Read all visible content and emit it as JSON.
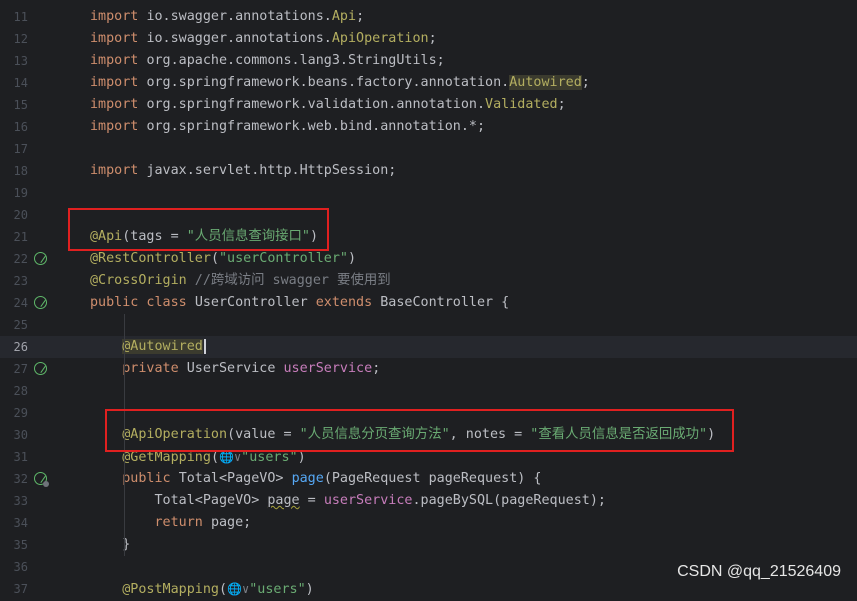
{
  "editor": {
    "lines": [
      {
        "n": "11",
        "parts": [
          [
            "kw",
            "import "
          ],
          [
            "",
            "io.swagger.annotations."
          ],
          [
            "ann",
            "Api"
          ],
          [
            "",
            ";"
          ]
        ]
      },
      {
        "n": "12",
        "parts": [
          [
            "kw",
            "import "
          ],
          [
            "",
            "io.swagger.annotations."
          ],
          [
            "ann",
            "ApiOperation"
          ],
          [
            "",
            ";"
          ]
        ]
      },
      {
        "n": "13",
        "parts": [
          [
            "kw",
            "import "
          ],
          [
            "",
            "org.apache.commons.lang3.StringUtils;"
          ]
        ]
      },
      {
        "n": "14",
        "parts": [
          [
            "kw",
            "import "
          ],
          [
            "",
            "org.springframework.beans.factory.annotation."
          ],
          [
            "ann hl",
            "Autowired"
          ],
          [
            "",
            ";"
          ]
        ]
      },
      {
        "n": "15",
        "parts": [
          [
            "kw",
            "import "
          ],
          [
            "",
            "org.springframework.validation.annotation."
          ],
          [
            "ann",
            "Validated"
          ],
          [
            "",
            ";"
          ]
        ]
      },
      {
        "n": "16",
        "parts": [
          [
            "kw",
            "import "
          ],
          [
            "",
            "org.springframework.web.bind.annotation.*;"
          ]
        ]
      },
      {
        "n": "17",
        "parts": []
      },
      {
        "n": "18",
        "parts": [
          [
            "kw",
            "import "
          ],
          [
            "",
            "javax.servlet.http.HttpSession;"
          ]
        ]
      },
      {
        "n": "19",
        "parts": []
      },
      {
        "n": "20",
        "parts": []
      },
      {
        "n": "21",
        "parts": [
          [
            "ann",
            "@Api"
          ],
          [
            "",
            "(tags = "
          ],
          [
            "str",
            "\"人员信息查询接口\""
          ],
          [
            "",
            ")"
          ]
        ]
      },
      {
        "n": "22",
        "icon": "bean",
        "parts": [
          [
            "ann",
            "@RestController"
          ],
          [
            "",
            "("
          ],
          [
            "str",
            "\"userController\""
          ],
          [
            "",
            ")"
          ]
        ]
      },
      {
        "n": "23",
        "parts": [
          [
            "ann",
            "@CrossOrigin"
          ],
          [
            "cmt",
            " //跨域访问 swagger 要使用到"
          ]
        ]
      },
      {
        "n": "24",
        "icon": "bean",
        "parts": [
          [
            "kw",
            "public class "
          ],
          [
            "",
            "UserController "
          ],
          [
            "kw",
            "extends "
          ],
          [
            "",
            "BaseController {"
          ]
        ]
      },
      {
        "n": "25",
        "parts": []
      },
      {
        "n": "26",
        "current": true,
        "parts": [
          [
            "",
            "    "
          ],
          [
            "ann hl",
            "@Autowired"
          ],
          [
            "caret",
            ""
          ]
        ]
      },
      {
        "n": "27",
        "icon": "bean-arrow",
        "parts": [
          [
            "",
            "    "
          ],
          [
            "kw",
            "private "
          ],
          [
            "",
            "UserService "
          ],
          [
            "fld",
            "userService"
          ],
          [
            "",
            ";"
          ]
        ]
      },
      {
        "n": "28",
        "parts": []
      },
      {
        "n": "29",
        "parts": []
      },
      {
        "n": "30",
        "parts": [
          [
            "",
            "    "
          ],
          [
            "ann",
            "@ApiOperation"
          ],
          [
            "",
            "(value = "
          ],
          [
            "str",
            "\"人员信息分页查询方法\""
          ],
          [
            "",
            ", notes = "
          ],
          [
            "str",
            "\"查看人员信息是否返回成功\""
          ],
          [
            "",
            ")"
          ]
        ]
      },
      {
        "n": "31",
        "parts": [
          [
            "",
            "    "
          ],
          [
            "ann",
            "@GetMapping"
          ],
          [
            "",
            "("
          ],
          [
            "inlay",
            "🌐∨"
          ],
          [
            "str",
            "\"users\""
          ],
          [
            "",
            ")"
          ]
        ]
      },
      {
        "n": "32",
        "icon": "bean-dot",
        "parts": [
          [
            "",
            "    "
          ],
          [
            "kw",
            "public "
          ],
          [
            "",
            "Total<PageVO> "
          ],
          [
            "fn",
            "page"
          ],
          [
            "",
            "(PageRequest pageRequest) {"
          ]
        ]
      },
      {
        "n": "33",
        "parts": [
          [
            "",
            "        Total<PageVO> "
          ],
          [
            "wavy",
            "page"
          ],
          [
            "",
            " = "
          ],
          [
            "fld",
            "userService"
          ],
          [
            "",
            ".pageBySQL(pageRequest);"
          ]
        ]
      },
      {
        "n": "34",
        "parts": [
          [
            "",
            "        "
          ],
          [
            "kw",
            "return "
          ],
          [
            "",
            "page;"
          ]
        ]
      },
      {
        "n": "35",
        "parts": [
          [
            "",
            "    }"
          ]
        ]
      },
      {
        "n": "36",
        "parts": []
      },
      {
        "n": "37",
        "parts": [
          [
            "",
            "    "
          ],
          [
            "ann",
            "@PostMapping"
          ],
          [
            "",
            "("
          ],
          [
            "inlay",
            "🌐∨"
          ],
          [
            "str",
            "\"users\""
          ],
          [
            "",
            ")"
          ]
        ]
      }
    ]
  },
  "watermark": "CSDN @qq_21526409",
  "colors": {
    "highlight_box": "#e02020",
    "background": "#1e1f22"
  }
}
